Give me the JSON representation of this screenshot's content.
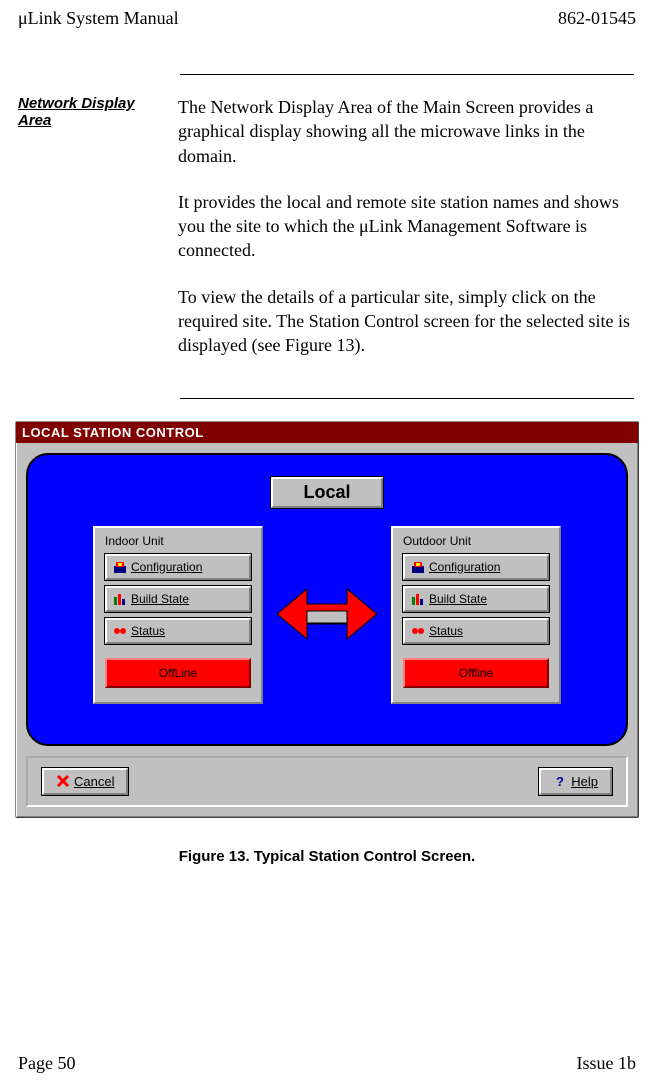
{
  "header": {
    "left": "μLink System Manual",
    "right": "862-01545"
  },
  "sidebar": {
    "label": "Network Display Area"
  },
  "body": {
    "p1": "The Network Display Area of the Main Screen provides a graphical display showing all the microwave links in the domain.",
    "p2": "It provides the local and remote site station names and shows you the site to which the μLink Management Software is connected.",
    "p3": "To view the details of a particular site, simply click on the required site.  The Station Control screen for the selected site is displayed (see Figure 13)."
  },
  "screenshot": {
    "titlebar": "LOCAL STATION CONTROL",
    "local_label": "Local",
    "indoor": {
      "title": "Indoor Unit",
      "config": "Configuration",
      "build": "Build State",
      "status": "Status",
      "state": "OffLine"
    },
    "outdoor": {
      "title": "Outdoor Unit",
      "config": "Configuration",
      "build": "Build State",
      "status": "Status",
      "state": "Offline"
    },
    "cancel": "Cancel",
    "help": "Help"
  },
  "caption": "Figure 13.  Typical Station Control Screen.",
  "footer": {
    "left": "Page 50",
    "right": "Issue 1b"
  }
}
